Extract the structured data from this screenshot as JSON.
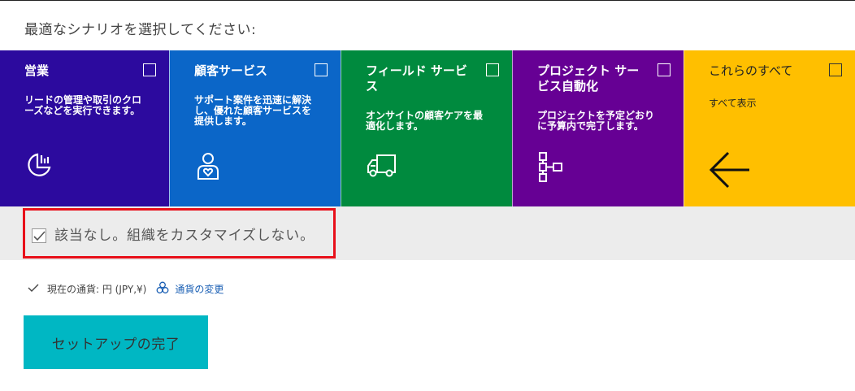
{
  "prompt": "最適なシナリオを選択してください:",
  "tiles": [
    {
      "title": "営業",
      "desc": "リードの管理や取引のクローズなどを実行できます。",
      "icon": "chart-icon",
      "color": "#2c0a9e"
    },
    {
      "title": "顧客サービス",
      "desc": "サポート案件を迅速に解決し、優れた顧客サービスを提供します。",
      "icon": "person-heart-icon",
      "color": "#0b66c8"
    },
    {
      "title": "フィールド サービス",
      "desc": "オンサイトの顧客ケアを最適化します。",
      "icon": "truck-icon",
      "color": "#008a3e"
    },
    {
      "title": "プロジェクト サービス自動化",
      "desc": "プロジェクトを予定どおりに予算内で完了します。",
      "icon": "org-chart-icon",
      "color": "#660094"
    },
    {
      "title": "これらのすべて",
      "desc": "すべて表示",
      "icon": "arrow-left-icon",
      "color": "#ffbf00"
    }
  ],
  "none_option": {
    "label": "該当なし。組織をカスタマイズしない。",
    "checked": true
  },
  "currency": {
    "label": "現在の通貨: 円 (JPY,¥)",
    "change_label": "通貨の変更"
  },
  "finish_button": "セットアップの完了"
}
